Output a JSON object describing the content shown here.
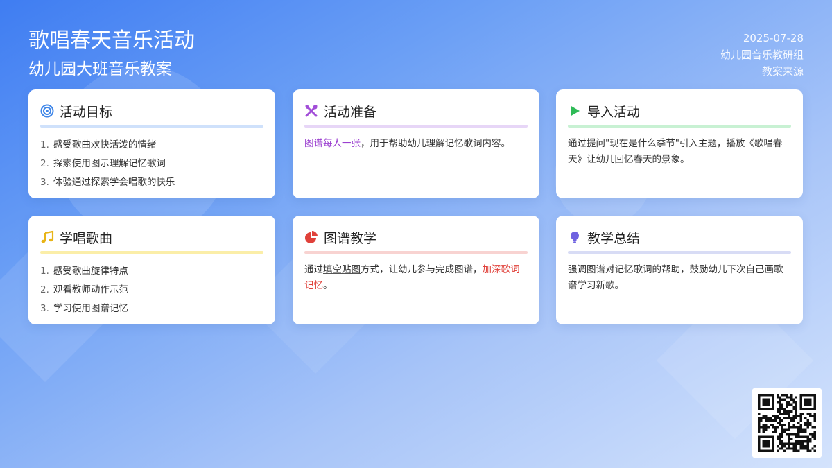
{
  "header": {
    "title": "歌唱春天音乐活动",
    "subtitle": "幼儿园大班音乐教案",
    "date": "2025-07-28",
    "org": "幼儿园音乐教研组",
    "source": "教案来源"
  },
  "cards": {
    "goals": {
      "title": "活动目标",
      "icon": "target-icon",
      "color": "#3f86e8",
      "line_color": "#cfe1fb",
      "items": [
        {
          "num": "1.",
          "text": "感受歌曲欢快活泼的情绪"
        },
        {
          "num": "2.",
          "text": "探索使用图示理解记忆歌词"
        },
        {
          "num": "3.",
          "text": "体验通过探索学会唱歌的快乐"
        }
      ]
    },
    "prep": {
      "title": "活动准备",
      "icon": "tools-icon",
      "color": "#a24ed8",
      "line_color": "#e7d6f7",
      "highlight": "图谱每人一张",
      "text": "，用于帮助幼儿理解记忆歌词内容。"
    },
    "intro": {
      "title": "导入活动",
      "icon": "play-icon",
      "color": "#2fbb57",
      "line_color": "#c8f1d3",
      "text": "通过提问\"现在是什么季节\"引入主题，播放《歌唱春天》让幼儿回忆春天的景象。"
    },
    "learn": {
      "title": "学唱歌曲",
      "icon": "music-note-icon",
      "color": "#e8b417",
      "line_color": "#fbeea8",
      "items": [
        {
          "num": "1.",
          "text": "感受歌曲旋律特点"
        },
        {
          "num": "2.",
          "text": "观看教师动作示范"
        },
        {
          "num": "3.",
          "text": "学习使用图谱记忆"
        }
      ]
    },
    "chart": {
      "title": "图谱教学",
      "icon": "pie-chart-icon",
      "color": "#e0413a",
      "line_color": "#f8d3d1",
      "pre": "通过",
      "underlined": "填空贴图",
      "mid": "方式，让幼儿参与完成图谱，",
      "highlight": "加深歌词记忆",
      "post": "。"
    },
    "summary": {
      "title": "教学总结",
      "icon": "lightbulb-icon",
      "color": "#6f62e0",
      "line_color": "#d8dcf5",
      "text": "强调图谱对记忆歌词的帮助，鼓励幼儿下次自己画歌谱学习新歌。"
    }
  },
  "qr": {
    "icon": "qr-code-icon"
  }
}
